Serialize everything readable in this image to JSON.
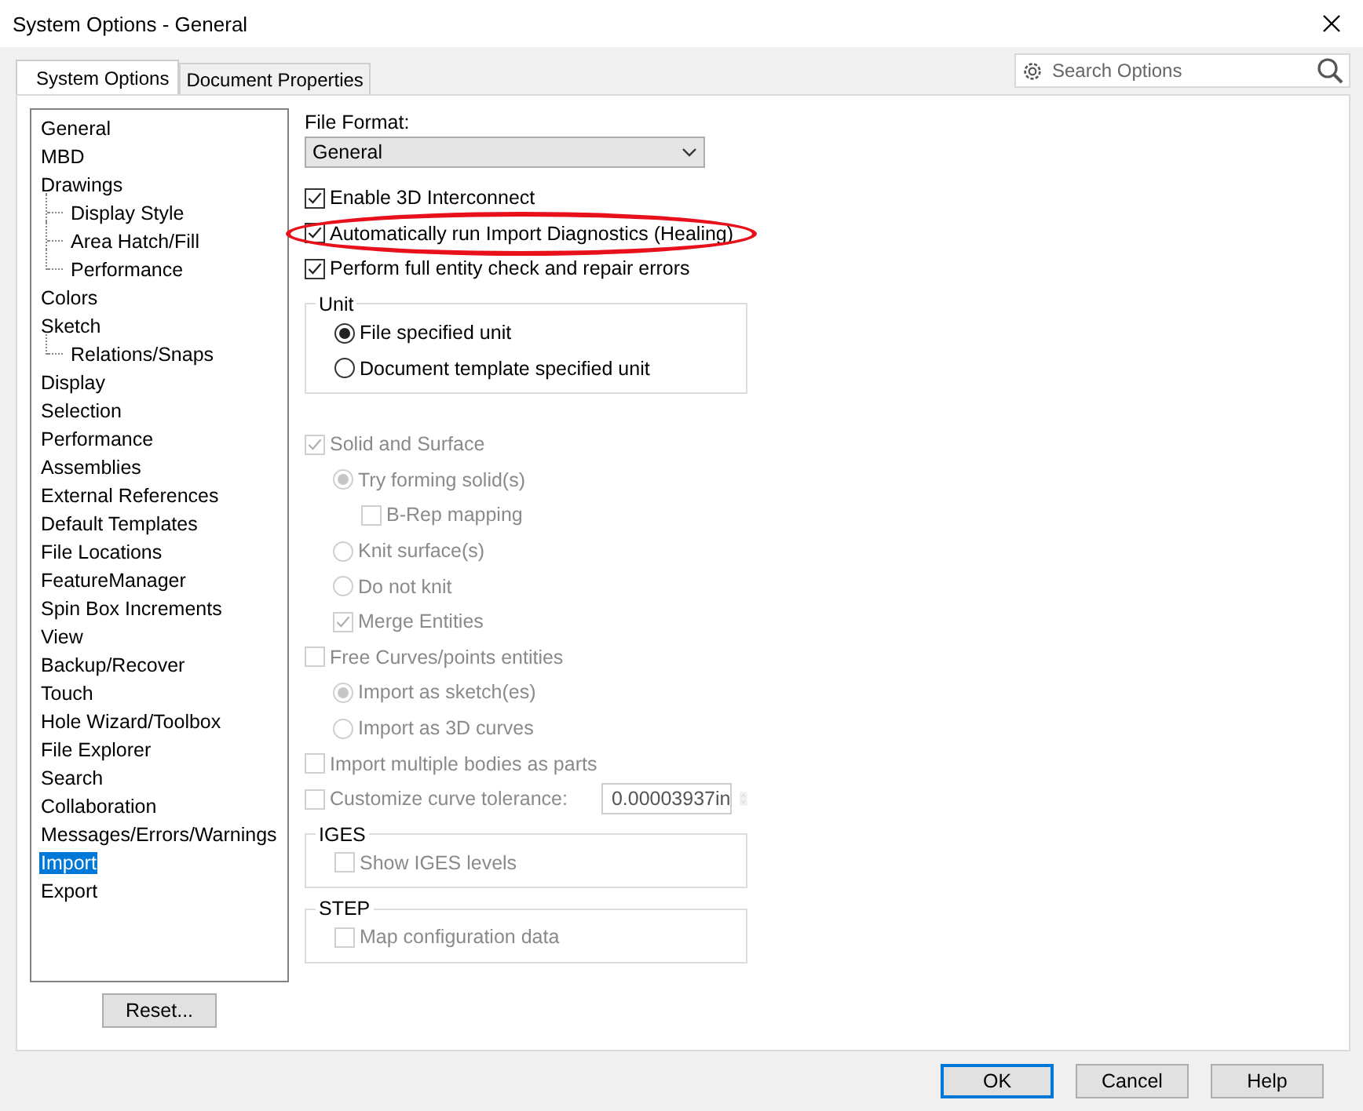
{
  "window": {
    "title": "System Options - General"
  },
  "tabs": [
    {
      "label": "System Options",
      "selected": true
    },
    {
      "label": "Document Properties",
      "selected": false
    }
  ],
  "search": {
    "placeholder": "Search Options"
  },
  "tree": [
    {
      "label": "General",
      "selected": false
    },
    {
      "label": "MBD",
      "selected": false
    },
    {
      "label": "Drawings",
      "selected": false,
      "children": [
        {
          "label": "Display Style",
          "selected": false
        },
        {
          "label": "Area Hatch/Fill",
          "selected": false
        },
        {
          "label": "Performance",
          "selected": false
        }
      ]
    },
    {
      "label": "Colors",
      "selected": false
    },
    {
      "label": "Sketch",
      "selected": false,
      "children": [
        {
          "label": "Relations/Snaps",
          "selected": false
        }
      ]
    },
    {
      "label": "Display",
      "selected": false
    },
    {
      "label": "Selection",
      "selected": false
    },
    {
      "label": "Performance",
      "selected": false
    },
    {
      "label": "Assemblies",
      "selected": false
    },
    {
      "label": "External References",
      "selected": false
    },
    {
      "label": "Default Templates",
      "selected": false
    },
    {
      "label": "File Locations",
      "selected": false
    },
    {
      "label": "FeatureManager",
      "selected": false
    },
    {
      "label": "Spin Box Increments",
      "selected": false
    },
    {
      "label": "View",
      "selected": false
    },
    {
      "label": "Backup/Recover",
      "selected": false
    },
    {
      "label": "Touch",
      "selected": false
    },
    {
      "label": "Hole Wizard/Toolbox",
      "selected": false
    },
    {
      "label": "File Explorer",
      "selected": false
    },
    {
      "label": "Search",
      "selected": false
    },
    {
      "label": "Collaboration",
      "selected": false
    },
    {
      "label": "Messages/Errors/Warnings",
      "selected": false
    },
    {
      "label": "Import",
      "selected": true
    },
    {
      "label": "Export",
      "selected": false
    }
  ],
  "reset_button": "Reset...",
  "file_format": {
    "label": "File Format:",
    "value": "General"
  },
  "options": [
    {
      "kind": "checkbox",
      "label": "Enable 3D Interconnect",
      "checked": true,
      "disabled": false,
      "highlighted": false
    },
    {
      "kind": "checkbox",
      "label": "Automatically run Import Diagnostics (Healing)",
      "checked": true,
      "disabled": false,
      "highlighted": true
    },
    {
      "kind": "checkbox",
      "label": "Perform full entity check and repair errors",
      "checked": true,
      "disabled": false,
      "highlighted": false
    },
    {
      "kind": "group",
      "title": "Unit",
      "children": [
        {
          "kind": "radio",
          "label": "File specified unit",
          "selected": true,
          "disabled": false
        },
        {
          "kind": "radio",
          "label": "Document template specified unit",
          "selected": false,
          "disabled": false
        }
      ]
    },
    {
      "kind": "spacer"
    },
    {
      "kind": "checkbox",
      "label": "Solid and Surface",
      "checked": true,
      "disabled": true,
      "highlighted": false,
      "children": [
        {
          "kind": "radio",
          "label": "Try forming solid(s)",
          "selected": true,
          "disabled": true,
          "children": [
            {
              "kind": "checkbox",
              "label": "B-Rep mapping",
              "checked": false,
              "disabled": true,
              "highlighted": false
            }
          ]
        },
        {
          "kind": "radio",
          "label": "Knit surface(s)",
          "selected": false,
          "disabled": true
        },
        {
          "kind": "radio",
          "label": "Do not knit",
          "selected": false,
          "disabled": true
        },
        {
          "kind": "checkbox",
          "label": "Merge Entities",
          "checked": true,
          "disabled": true,
          "highlighted": false
        }
      ]
    },
    {
      "kind": "checkbox",
      "label": "Free Curves/points entities",
      "checked": false,
      "disabled": true,
      "highlighted": false,
      "children": [
        {
          "kind": "radio",
          "label": "Import as sketch(es)",
          "selected": true,
          "disabled": true
        },
        {
          "kind": "radio",
          "label": "Import as 3D curves",
          "selected": false,
          "disabled": true
        }
      ]
    },
    {
      "kind": "checkbox",
      "label": "Import multiple bodies as parts",
      "checked": false,
      "disabled": true,
      "highlighted": false
    },
    {
      "kind": "tolerance",
      "label": "Customize curve tolerance:",
      "checked": false,
      "disabled": true,
      "highlighted": false,
      "value": "0.00003937in"
    },
    {
      "kind": "group",
      "title": "IGES",
      "children": [
        {
          "kind": "checkbox",
          "label": "Show IGES levels",
          "checked": false,
          "disabled": true,
          "highlighted": false
        }
      ]
    },
    {
      "kind": "group",
      "title": "STEP",
      "children": [
        {
          "kind": "checkbox",
          "label": "Map configuration data",
          "checked": false,
          "disabled": true,
          "highlighted": false
        }
      ]
    }
  ],
  "buttons": [
    {
      "label": "OK",
      "default": true
    },
    {
      "label": "Cancel",
      "default": false
    },
    {
      "label": "Help",
      "default": false
    }
  ]
}
